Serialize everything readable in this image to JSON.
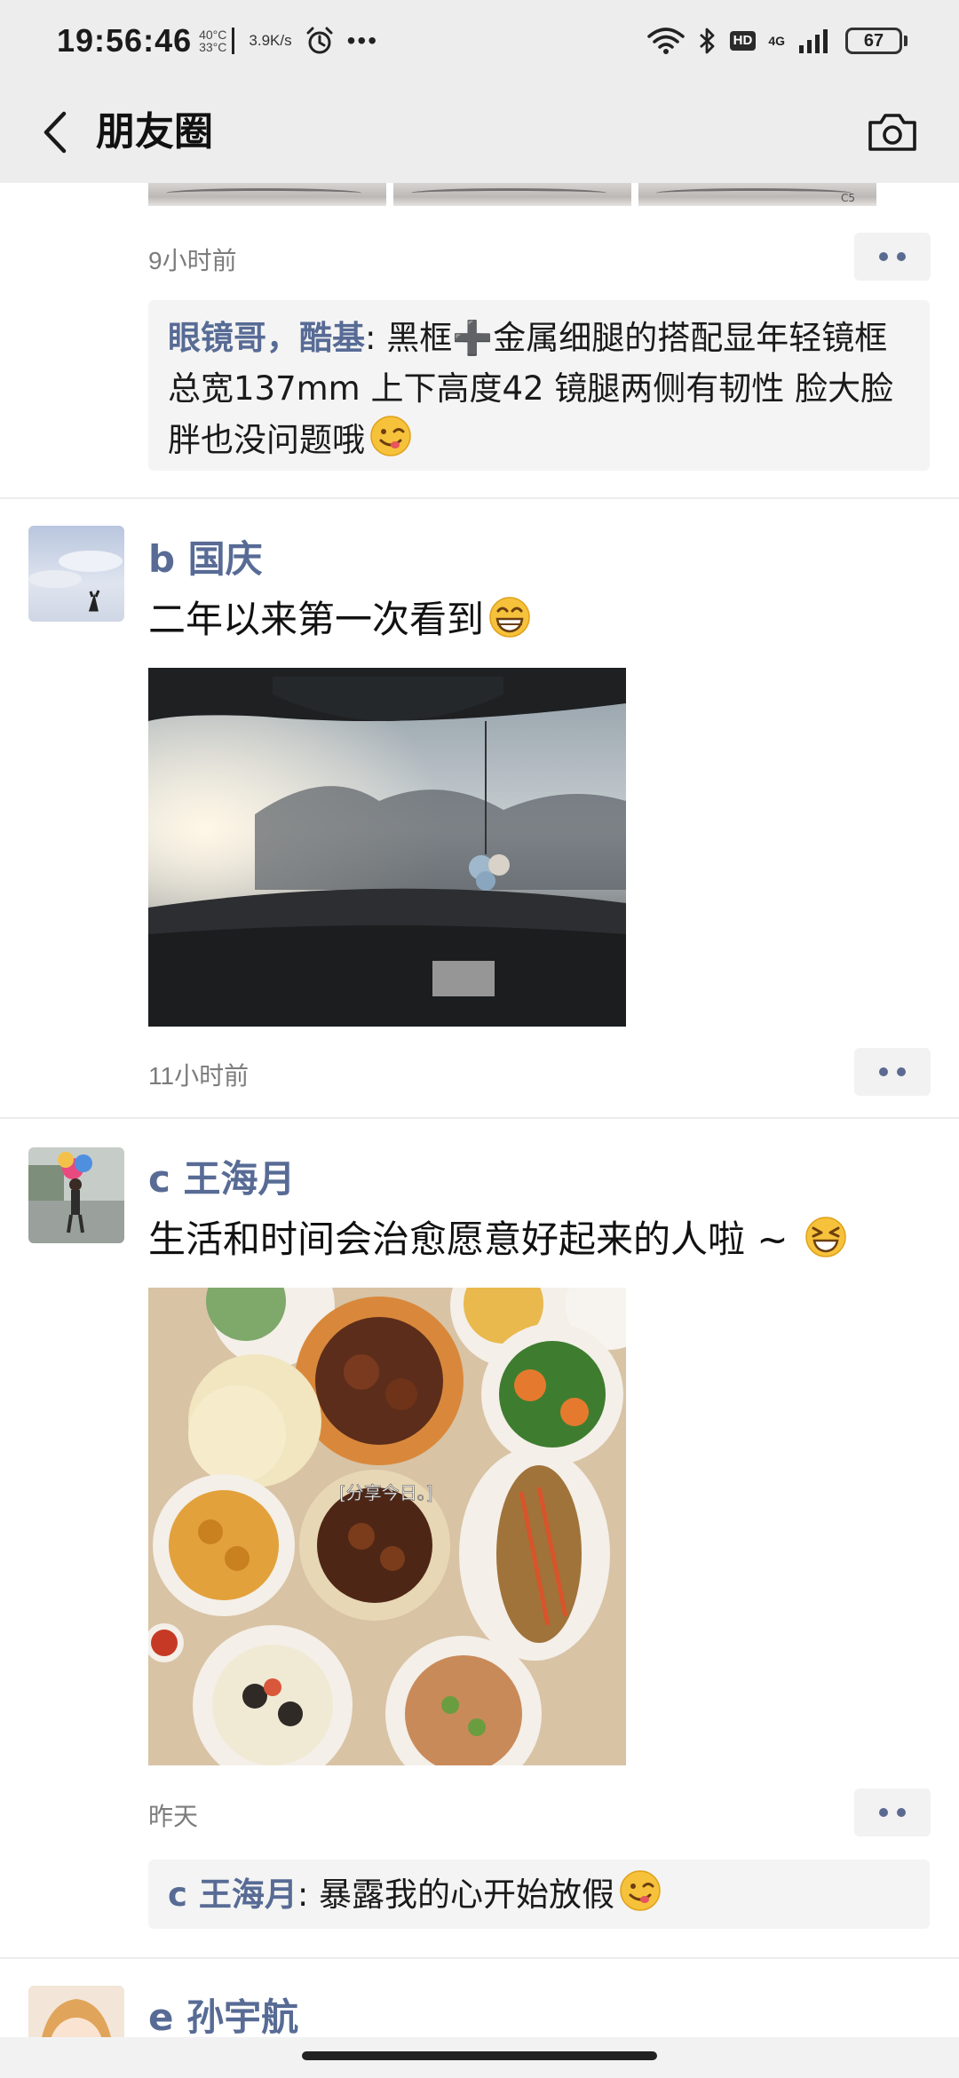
{
  "status_bar": {
    "time": "19:56:46",
    "temp_high": "40°C",
    "temp_low": "33°C",
    "net_speed": "3.9K/s",
    "more": "•••",
    "hd": "HD",
    "network": "4G",
    "battery": "67"
  },
  "nav": {
    "title": "朋友圈"
  },
  "posts": [
    {
      "time": "9小时前",
      "comments": [
        {
          "name": "眼镜哥，酷基",
          "text": ": 黑框➕金属细腿的搭配显年轻镜框总宽137mm 上下高度42 镜腿两侧有韧性 脸大脸胖也没问题哦"
        }
      ],
      "thumb_tag": "C5"
    },
    {
      "user": "b 国庆",
      "text": "二年以来第一次看到",
      "time": "11小时前"
    },
    {
      "user": "c 王海月",
      "text": "生活和时间会治愈愿意好起来的人啦 ~ ",
      "photo_caption": "[分享今日。]",
      "time": "昨天",
      "comments": [
        {
          "name": "c 王海月",
          "text": ": 暴露我的心开始放假"
        }
      ]
    },
    {
      "user": "e 孙宇航"
    }
  ],
  "icons": {
    "back": "chevron-left-icon",
    "camera": "camera-icon",
    "more": "more-dots-icon"
  },
  "colors": {
    "link_blue": "#576b95",
    "nav_bg": "#ededed",
    "comment_bg": "#f4f4f4"
  }
}
